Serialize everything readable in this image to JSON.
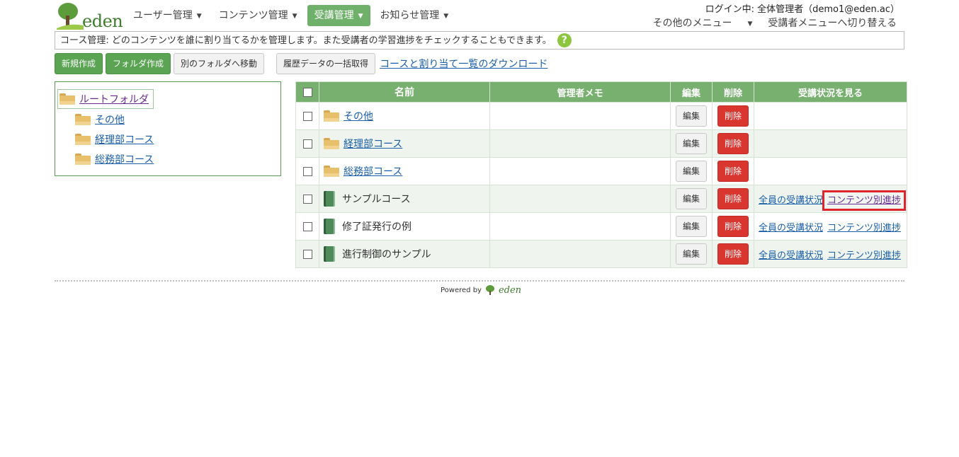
{
  "brand": {
    "logo_text": "eden",
    "powered_by": "Powered by",
    "powered_logo_text": "eden"
  },
  "nav": {
    "items": [
      {
        "label": "ユーザー管理"
      },
      {
        "label": "コンテンツ管理"
      },
      {
        "label": "受講管理"
      },
      {
        "label": "お知らせ管理"
      }
    ]
  },
  "header": {
    "login_info": "ログイン中: 全体管理者（demo1@eden.ac）",
    "other_menu": "その他のメニュー",
    "switch_menu": "受講者メニューへ切り替える"
  },
  "info_bar": {
    "text": "コース管理: どのコンテンツを誰に割り当てるかを管理します。また受講者の学習進捗をチェックすることもできます。",
    "help_glyph": "?"
  },
  "toolbar": {
    "new": "新規作成",
    "new_folder": "フォルダ作成",
    "move": "別のフォルダへ移動",
    "history": "履歴データの一括取得",
    "download": "コースと割り当て一覧のダウンロード"
  },
  "tree": {
    "root": "ルートフォルダ",
    "children": [
      "その他",
      "経理部コース",
      "総務部コース"
    ]
  },
  "table": {
    "headers": {
      "name": "名前",
      "memo": "管理者メモ",
      "edit": "編集",
      "delete": "削除",
      "status": "受講状況を見る"
    },
    "edit_label": "編集",
    "delete_label": "削除",
    "all_status_label": "全員の受講状況",
    "content_progress_label": "コンテンツ別進捗",
    "rows": [
      {
        "name": "その他",
        "type": "folder"
      },
      {
        "name": "経理部コース",
        "type": "folder"
      },
      {
        "name": "総務部コース",
        "type": "folder"
      },
      {
        "name": "サンプルコース",
        "type": "course"
      },
      {
        "name": "修了証発行の例",
        "type": "course"
      },
      {
        "name": "進行制御のサンプル",
        "type": "course"
      }
    ]
  },
  "colors": {
    "accent": "#6fb06a",
    "danger": "#d9362f",
    "highlight": "#e0242b"
  }
}
